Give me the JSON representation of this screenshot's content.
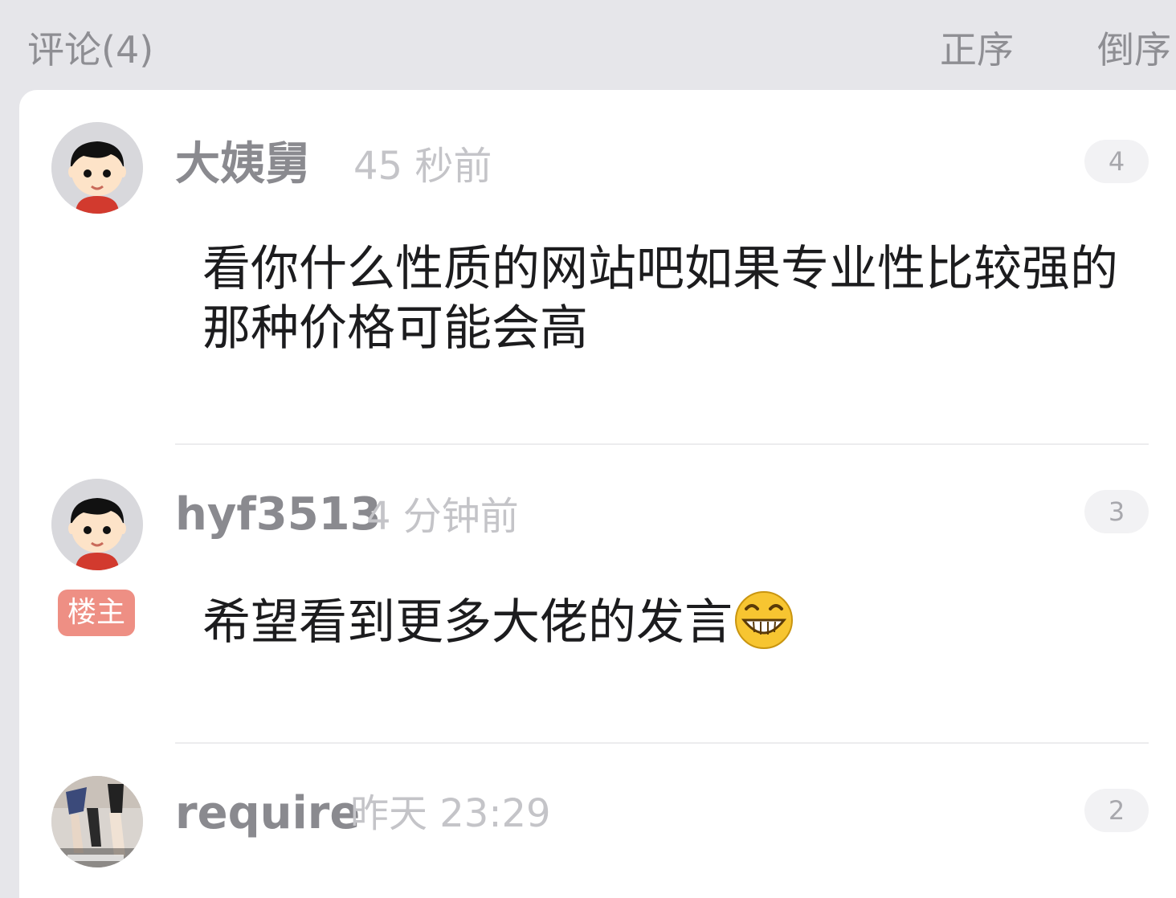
{
  "header": {
    "title": "评论(4)",
    "sort_asc": "正序",
    "sort_desc": "倒序"
  },
  "comments": [
    {
      "username": "大姨舅",
      "time": "45 秒前",
      "count": "4",
      "content": "看你什么性质的网站吧如果专业性比较强的那种价格可能会高",
      "avatar": "cartoon-boy-avatar"
    },
    {
      "username": "hyf3513",
      "time": "4 分钟前",
      "count": "3",
      "badge": "楼主",
      "content": "希望看到更多大佬的发言",
      "emoji": "grinning-emoji",
      "avatar": "cartoon-boy-avatar"
    },
    {
      "username": "require",
      "time": "昨天 23:29",
      "count": "2",
      "avatar": "photo-avatar"
    }
  ],
  "colors": {
    "background": "#e6e6ea",
    "card": "#ffffff",
    "op_badge": "#ee8f84",
    "username": "#8a8a8f",
    "time": "#c4c4c8"
  }
}
